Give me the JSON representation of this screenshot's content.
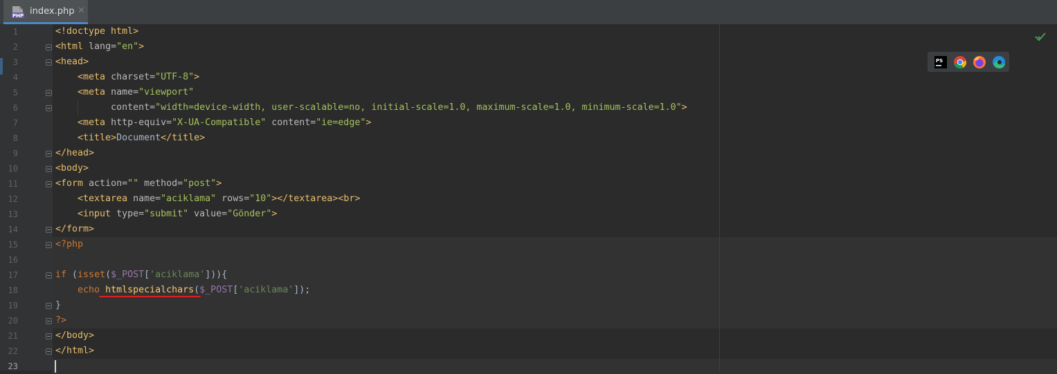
{
  "tab": {
    "label": "index.php",
    "close": "✕"
  },
  "icons": {
    "php_file": "php-file-icon",
    "close": "close-icon",
    "inspection_ok": "check-icon",
    "browsers": [
      "phpstorm-icon",
      "chrome-icon",
      "firefox-icon",
      "edge-icon"
    ]
  },
  "line_numbers": [
    "1",
    "2",
    "3",
    "4",
    "5",
    "6",
    "7",
    "8",
    "9",
    "10",
    "11",
    "12",
    "13",
    "14",
    "15",
    "16",
    "17",
    "18",
    "19",
    "20",
    "21",
    "22",
    "23"
  ],
  "code_lines": [
    [
      {
        "t": "<!doctype html>",
        "c": "tag"
      }
    ],
    [
      {
        "t": "<html ",
        "c": "tag"
      },
      {
        "t": "lang=",
        "c": "attr"
      },
      {
        "t": "\"en\"",
        "c": "str"
      },
      {
        "t": ">",
        "c": "tag"
      }
    ],
    [
      {
        "t": "<head>",
        "c": "tag"
      }
    ],
    [
      {
        "t": "    <meta ",
        "c": "tag"
      },
      {
        "t": "charset=",
        "c": "attr"
      },
      {
        "t": "\"UTF-8\"",
        "c": "str"
      },
      {
        "t": ">",
        "c": "tag"
      }
    ],
    [
      {
        "t": "    <meta ",
        "c": "tag"
      },
      {
        "t": "name=",
        "c": "attr"
      },
      {
        "t": "\"viewport\"",
        "c": "str"
      }
    ],
    [
      {
        "t": "          content=",
        "c": "attr"
      },
      {
        "t": "\"width=device-width, user-scalable=no, initial-scale=1.0, maximum-scale=1.0, minimum-scale=1.0\"",
        "c": "str"
      },
      {
        "t": ">",
        "c": "tag"
      }
    ],
    [
      {
        "t": "    <meta ",
        "c": "tag"
      },
      {
        "t": "http-equiv=",
        "c": "attr"
      },
      {
        "t": "\"X-UA-Compatible\"",
        "c": "str"
      },
      {
        "t": " content=",
        "c": "attr"
      },
      {
        "t": "\"ie=edge\"",
        "c": "str"
      },
      {
        "t": ">",
        "c": "tag"
      }
    ],
    [
      {
        "t": "    <title>",
        "c": "tag"
      },
      {
        "t": "Document",
        "c": "punct"
      },
      {
        "t": "</title>",
        "c": "tag"
      }
    ],
    [
      {
        "t": "</head>",
        "c": "tag"
      }
    ],
    [
      {
        "t": "<body>",
        "c": "tag"
      }
    ],
    [
      {
        "t": "<form ",
        "c": "tag"
      },
      {
        "t": "action=",
        "c": "attr"
      },
      {
        "t": "\"\"",
        "c": "str"
      },
      {
        "t": " method=",
        "c": "attr"
      },
      {
        "t": "\"post\"",
        "c": "str"
      },
      {
        "t": ">",
        "c": "tag"
      }
    ],
    [
      {
        "t": "    <textarea ",
        "c": "tag"
      },
      {
        "t": "name=",
        "c": "attr"
      },
      {
        "t": "\"aciklama\"",
        "c": "str"
      },
      {
        "t": " rows=",
        "c": "attr"
      },
      {
        "t": "\"10\"",
        "c": "str"
      },
      {
        "t": "></textarea><br>",
        "c": "tag"
      }
    ],
    [
      {
        "t": "    <input ",
        "c": "tag"
      },
      {
        "t": "type=",
        "c": "attr"
      },
      {
        "t": "\"submit\"",
        "c": "str"
      },
      {
        "t": " value=",
        "c": "attr"
      },
      {
        "t": "\"Gönder\"",
        "c": "str"
      },
      {
        "t": ">",
        "c": "tag"
      }
    ],
    [
      {
        "t": "</form>",
        "c": "tag"
      }
    ],
    [
      {
        "t": "<?php",
        "c": "ptag"
      }
    ],
    [
      {
        "t": "",
        "c": "punct"
      }
    ],
    [
      {
        "t": "if ",
        "c": "kw"
      },
      {
        "t": "(",
        "c": "punct"
      },
      {
        "t": "isset",
        "c": "kw"
      },
      {
        "t": "(",
        "c": "punct"
      },
      {
        "t": "$_POST",
        "c": "var"
      },
      {
        "t": "[",
        "c": "punct"
      },
      {
        "t": "'aciklama'",
        "c": "pstr"
      },
      {
        "t": "])){",
        "c": "punct"
      }
    ],
    [
      {
        "t": "    echo ",
        "c": "kw"
      },
      {
        "t": "htmlspecialchars",
        "c": "fn"
      },
      {
        "t": "(",
        "c": "punct"
      },
      {
        "t": "$_POST",
        "c": "var"
      },
      {
        "t": "[",
        "c": "punct"
      },
      {
        "t": "'aciklama'",
        "c": "pstr"
      },
      {
        "t": "]);",
        "c": "punct"
      }
    ],
    [
      {
        "t": "}",
        "c": "punct"
      }
    ],
    [
      {
        "t": "?>",
        "c": "ptag"
      }
    ],
    [
      {
        "t": "</body>",
        "c": "tag"
      }
    ],
    [
      {
        "t": "</html>",
        "c": "tag"
      }
    ],
    [
      {
        "t": "",
        "c": "punct"
      }
    ]
  ],
  "cursor_line": "23"
}
